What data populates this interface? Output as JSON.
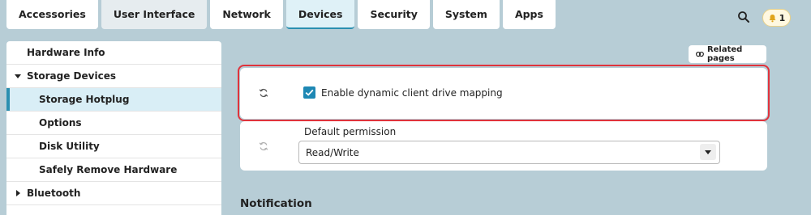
{
  "tabs": [
    {
      "label": "Accessories"
    },
    {
      "label": "User Interface"
    },
    {
      "label": "Network"
    },
    {
      "label": "Devices",
      "active": true
    },
    {
      "label": "Security"
    },
    {
      "label": "System"
    },
    {
      "label": "Apps"
    }
  ],
  "header": {
    "search_icon": "search-icon",
    "notifications": {
      "icon": "bell-icon",
      "count": "1"
    }
  },
  "sidebar": {
    "items": [
      {
        "label": "Hardware Info"
      },
      {
        "label": "Storage Devices",
        "expanded": true
      },
      {
        "label": "Storage Hotplug",
        "active": true
      },
      {
        "label": "Options"
      },
      {
        "label": "Disk Utility"
      },
      {
        "label": "Safely Remove Hardware"
      },
      {
        "label": "Bluetooth",
        "expanded": false
      }
    ]
  },
  "main": {
    "related_pages_label": "Related pages",
    "setting_dynamic_mapping": {
      "label": "Enable dynamic client drive mapping",
      "checked": true
    },
    "default_permission": {
      "label": "Default permission",
      "value": "Read/Write"
    },
    "section_heading": "Notification"
  },
  "colors": {
    "background": "#b7cdd6",
    "accent": "#2b8fb0",
    "highlight_border": "#e0333c",
    "checkbox": "#1e88b4"
  }
}
